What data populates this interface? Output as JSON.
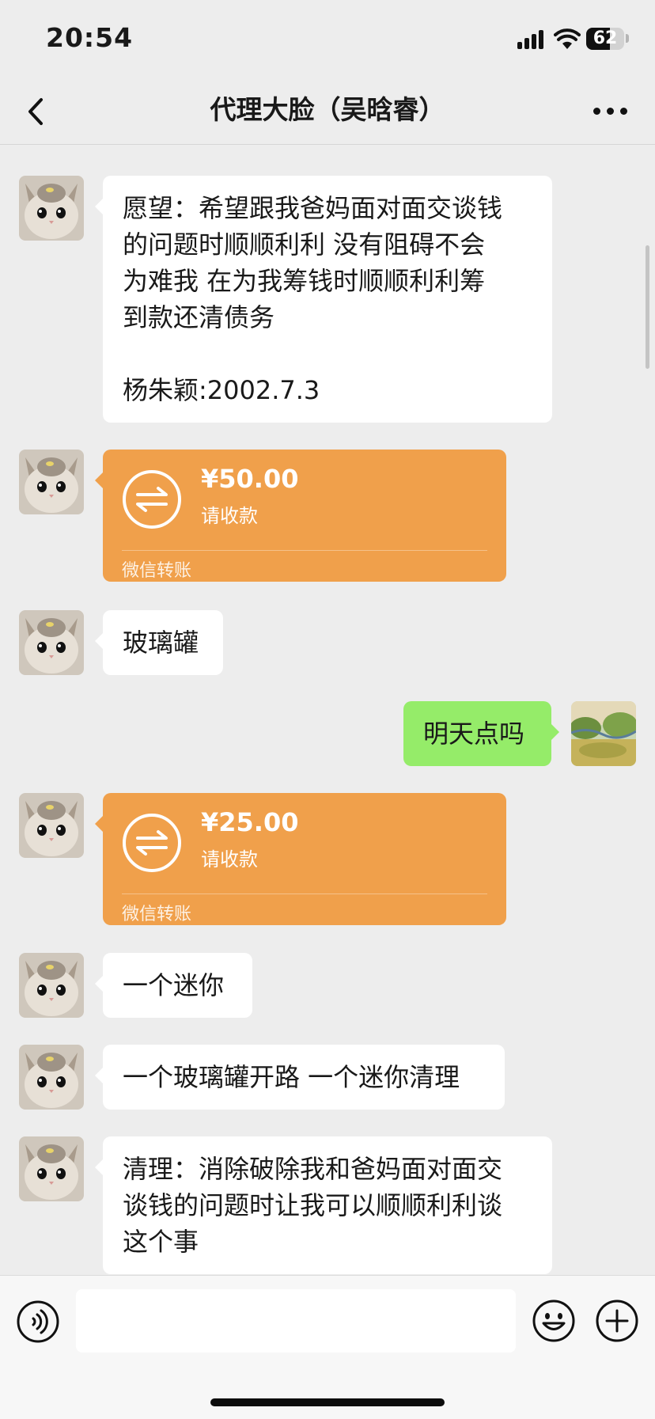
{
  "status_bar": {
    "time": "20:54",
    "battery": "62",
    "battery_level_pct": 62
  },
  "header": {
    "title": "代理大脸（吴晗睿）"
  },
  "messages": [
    {
      "side": "left",
      "type": "text",
      "text": "愿望：希望跟我爸妈面对面交谈钱\n的问题时顺顺利利 没有阻碍不会\n为难我 在为我筹钱时顺顺利利筹\n到款还清债务\n\n杨朱颖:2002.7.3"
    },
    {
      "side": "left",
      "type": "transfer",
      "amount": "¥50.00",
      "status": "请收款",
      "label": "微信转账"
    },
    {
      "side": "left",
      "type": "text",
      "text": "玻璃罐"
    },
    {
      "side": "right",
      "type": "text",
      "text": "明天点吗"
    },
    {
      "side": "left",
      "type": "transfer",
      "amount": "¥25.00",
      "status": "请收款",
      "label": "微信转账"
    },
    {
      "side": "left",
      "type": "text",
      "text": "一个迷你"
    },
    {
      "side": "left",
      "type": "text",
      "text": "一个玻璃罐开路 一个迷你清理"
    },
    {
      "side": "left",
      "type": "text",
      "text": "清理：消除破除我和爸妈面对面交\n谈钱的问题时让我可以顺顺利利谈\n这个事"
    }
  ],
  "icons": {
    "back": "chevron-left-icon",
    "more": "more-dots-icon",
    "transfer": "transfer-arrows-icon",
    "voice": "voice-icon",
    "emoji": "emoji-icon",
    "plus": "plus-icon"
  },
  "colors": {
    "background": "#ededed",
    "self_bubble": "#95ec69",
    "other_bubble": "#ffffff",
    "transfer_card": "#f0a04b"
  }
}
